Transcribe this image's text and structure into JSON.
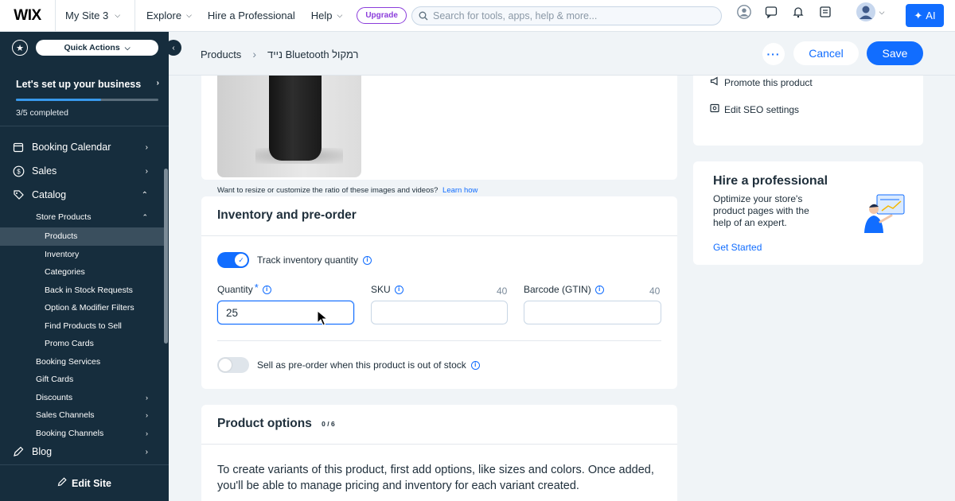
{
  "topbar": {
    "logo": "WIX",
    "site_name": "My Site 3",
    "nav": [
      "Explore",
      "Hire a Professional",
      "Help"
    ],
    "upgrade": "Upgrade",
    "search_placeholder": "Search for tools, apps, help & more...",
    "ai_label": "AI",
    "icons": [
      "avatar-group-icon",
      "chat-icon",
      "bell-icon",
      "inbox-icon",
      "user-avatar-icon"
    ]
  },
  "sidebar": {
    "quick_actions": "Quick Actions",
    "setup_title": "Let's set up your business",
    "setup_progress_label": "3/5 completed",
    "setup_progress_fraction": 0.6,
    "items": [
      {
        "label": "Booking Calendar",
        "icon": "calendar-icon"
      },
      {
        "label": "Sales",
        "icon": "dollar-icon"
      },
      {
        "label": "Catalog",
        "icon": "tag-icon"
      }
    ],
    "catalog_sub": {
      "store_products": "Store Products",
      "children": [
        "Products",
        "Inventory",
        "Categories",
        "Back in Stock Requests",
        "Option & Modifier Filters",
        "Find Products to Sell",
        "Promo Cards"
      ],
      "others": [
        "Booking Services",
        "Gift Cards",
        "Discounts",
        "Sales Channels",
        "Booking Channels"
      ]
    },
    "blog": "Blog",
    "edit_site": "Edit Site"
  },
  "header": {
    "breadcrumb_root": "Products",
    "breadcrumb_current": "רמקול Bluetooth נייד",
    "cancel": "Cancel",
    "save": "Save"
  },
  "media": {
    "resize_note": "Want to resize or customize the ratio of these images and videos?",
    "learn_how": "Learn how"
  },
  "inventory": {
    "title": "Inventory and pre-order",
    "track_label": "Track inventory quantity",
    "track_on": true,
    "quantity_label": "Quantity",
    "quantity_value": "25",
    "sku_label": "SKU",
    "sku_limit": "40",
    "barcode_label": "Barcode (GTIN)",
    "barcode_limit": "40",
    "preorder_label": "Sell as pre-order when this product is out of stock",
    "preorder_on": false
  },
  "options": {
    "title": "Product options",
    "count": "0 / 6",
    "text": "To create variants of this product, first add options, like sizes and colors. Once added, you'll be able to manage pricing and inventory for each variant created."
  },
  "seo": {
    "promote": "Promote this product",
    "edit_seo": "Edit SEO settings"
  },
  "hire": {
    "title": "Hire a professional",
    "text": "Optimize your store's product pages with the help of an expert.",
    "link": "Get Started"
  },
  "colors": {
    "accent": "#116dff",
    "sidebar_bg": "#162d3d",
    "upgrade": "#8b3ddb"
  }
}
